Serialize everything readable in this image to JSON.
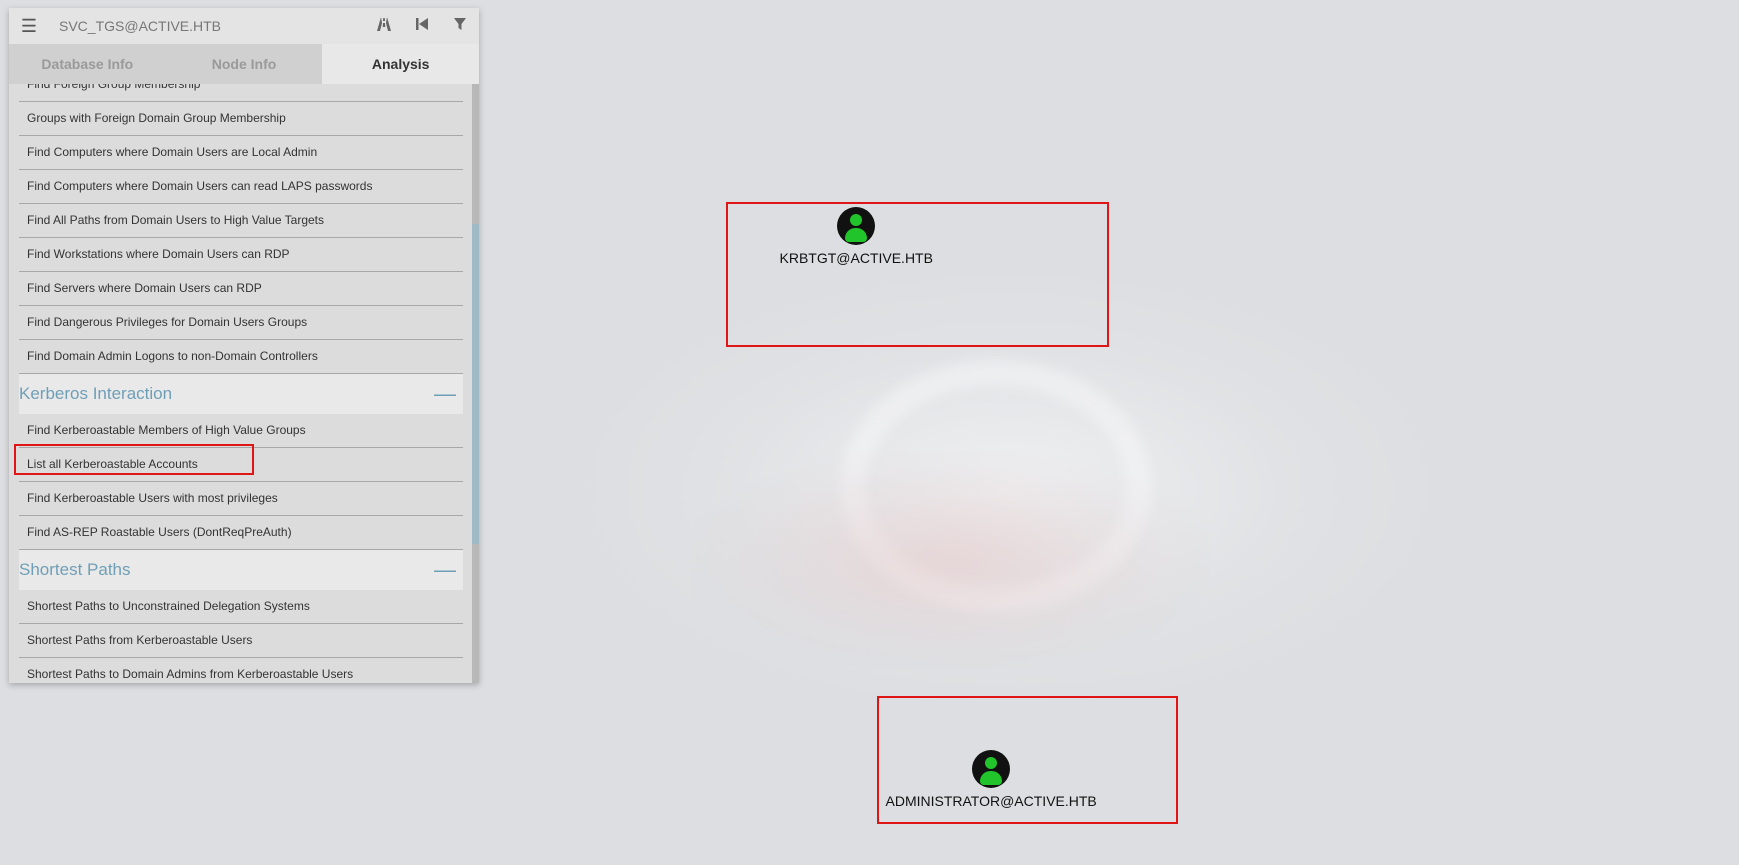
{
  "search": {
    "value": "SVC_TGS@ACTIVE.HTB"
  },
  "icons": {
    "menu": "hamburger-menu-icon",
    "pathfinding": "road-icon",
    "back": "step-back-icon",
    "filter": "filter-icon"
  },
  "tabs": [
    {
      "label": "Database Info",
      "active": false
    },
    {
      "label": "Node Info",
      "active": false
    },
    {
      "label": "Analysis",
      "active": true
    }
  ],
  "analysis": {
    "clipped_item": "Find Foreign Group Membership",
    "domain_items": [
      "Groups with Foreign Domain Group Membership",
      "Find Computers where Domain Users are Local Admin",
      "Find Computers where Domain Users can read LAPS passwords",
      "Find All Paths from Domain Users to High Value Targets",
      "Find Workstations where Domain Users can RDP",
      "Find Servers where Domain Users can RDP",
      "Find Dangerous Privileges for Domain Users Groups",
      "Find Domain Admin Logons to non-Domain Controllers"
    ],
    "kerberos": {
      "title": "Kerberos Interaction",
      "toggle": "—",
      "items": [
        "Find Kerberoastable Members of High Value Groups",
        "List all Kerberoastable Accounts",
        "Find Kerberoastable Users with most privileges",
        "Find AS-REP Roastable Users (DontReqPreAuth)"
      ]
    },
    "shortest": {
      "title": "Shortest Paths",
      "toggle": "—",
      "items": [
        "Shortest Paths to Unconstrained Delegation Systems",
        "Shortest Paths from Kerberoastable Users",
        "Shortest Paths to Domain Admins from Kerberoastable Users"
      ]
    }
  },
  "graph": {
    "nodes": [
      {
        "label": "KRBTGT@ACTIVE.HTB",
        "icon": "user-icon"
      },
      {
        "label": "ADMINISTRATOR@ACTIVE.HTB",
        "icon": "user-icon"
      }
    ]
  },
  "colors": {
    "highlight": "#e01616",
    "section": "#6f9fb6",
    "user_node": "#22c42c"
  }
}
